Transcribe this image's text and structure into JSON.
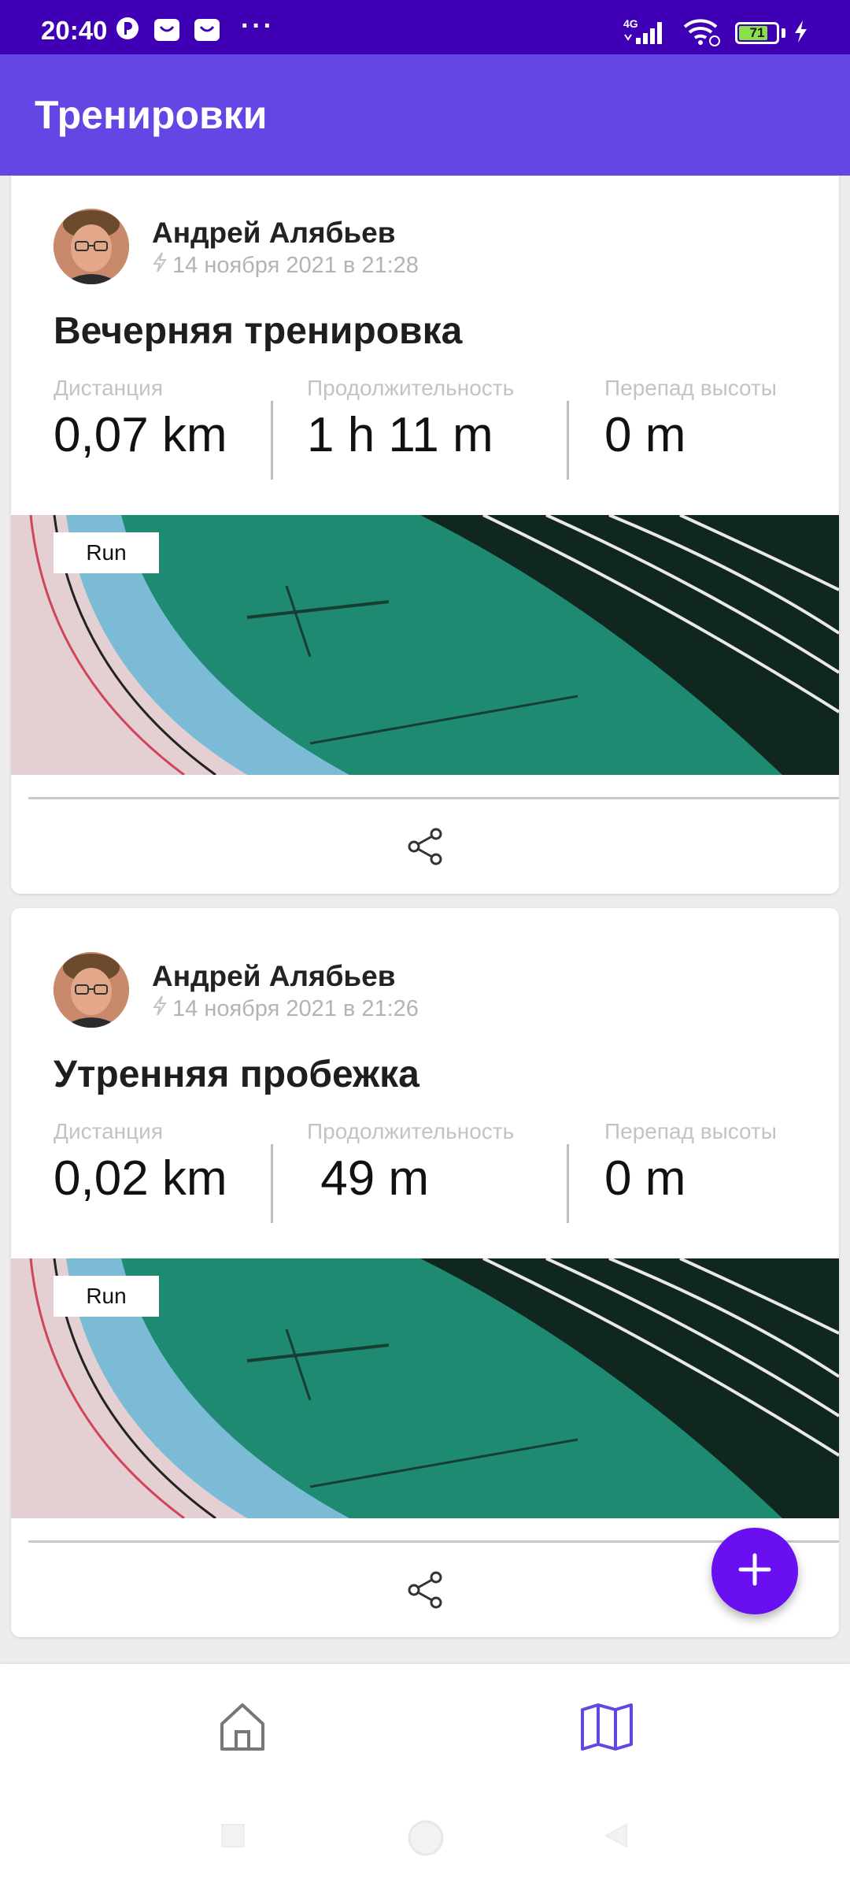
{
  "status_bar": {
    "time": "20:40",
    "network": "4G",
    "battery_level": "71",
    "icons": [
      "p-logo-icon",
      "shopping-bag-icon",
      "shopping-bag-icon",
      "more-dots-icon",
      "signal-icon",
      "wifi-icon",
      "battery-icon",
      "charging-icon"
    ]
  },
  "app_bar": {
    "title": "Тренировки"
  },
  "workouts": [
    {
      "author": "Андрей Алябьев",
      "date": "14 ноября 2021 в 21:28",
      "title": "Вечерняя тренировка",
      "stats": [
        {
          "label": "Дистанция",
          "value": "0,07 km"
        },
        {
          "label": "Продолжительность",
          "value": "1 h 11 m"
        },
        {
          "label": "Перепад высоты",
          "value": "0 m"
        }
      ],
      "type": "Run"
    },
    {
      "author": "Андрей Алябьев",
      "date": "14 ноября 2021 в 21:26",
      "title": "Утренняя пробежка",
      "stats": [
        {
          "label": "Дистанция",
          "value": "0,02 km"
        },
        {
          "label": "Продолжительность",
          "value": " 49 m"
        },
        {
          "label": "Перепад высоты",
          "value": "0 m"
        }
      ],
      "type": "Run"
    }
  ],
  "colors": {
    "status_bar": "#3f00b5",
    "app_bar": "#6346e3",
    "fab": "#6a0ff0",
    "nav_active": "#6346e3",
    "nav_inactive": "#777777"
  },
  "bottom_nav": {
    "items": [
      {
        "icon": "home-icon",
        "active": false
      },
      {
        "icon": "map-icon",
        "active": true
      }
    ]
  }
}
